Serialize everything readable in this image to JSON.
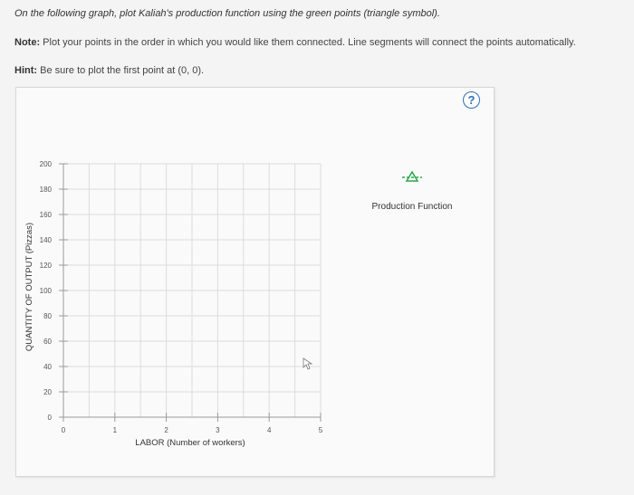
{
  "instructions": {
    "line1": "On the following graph, plot Kaliah's production function using the green points (triangle symbol).",
    "note_label": "Note:",
    "note_text": " Plot your points in the order in which you would like them connected. Line segments will connect the points automatically.",
    "hint_label": "Hint:",
    "hint_text": " Be sure to plot the first point at (0, 0)."
  },
  "help_button": {
    "label": "?",
    "icon": "question-icon"
  },
  "legend": {
    "label": "Production Function",
    "symbol": "triangle",
    "color": "#2aa84a"
  },
  "colors": {
    "grid": "#dcdcdc",
    "axis": "#9a9a9a",
    "help": "#2f6fb5",
    "triangle": "#2aa84a"
  },
  "chart_data": {
    "type": "scatter",
    "xlabel": "LABOR (Number of workers)",
    "ylabel": "QUANTITY OF OUTPUT (Pizzas)",
    "xlim": [
      0,
      5
    ],
    "ylim": [
      0,
      200
    ],
    "x_ticks": [
      "0",
      "1",
      "2",
      "3",
      "4",
      "5"
    ],
    "y_ticks": [
      "0",
      "20",
      "40",
      "60",
      "80",
      "100",
      "120",
      "140",
      "160",
      "180",
      "200"
    ],
    "grid": true,
    "series": []
  }
}
